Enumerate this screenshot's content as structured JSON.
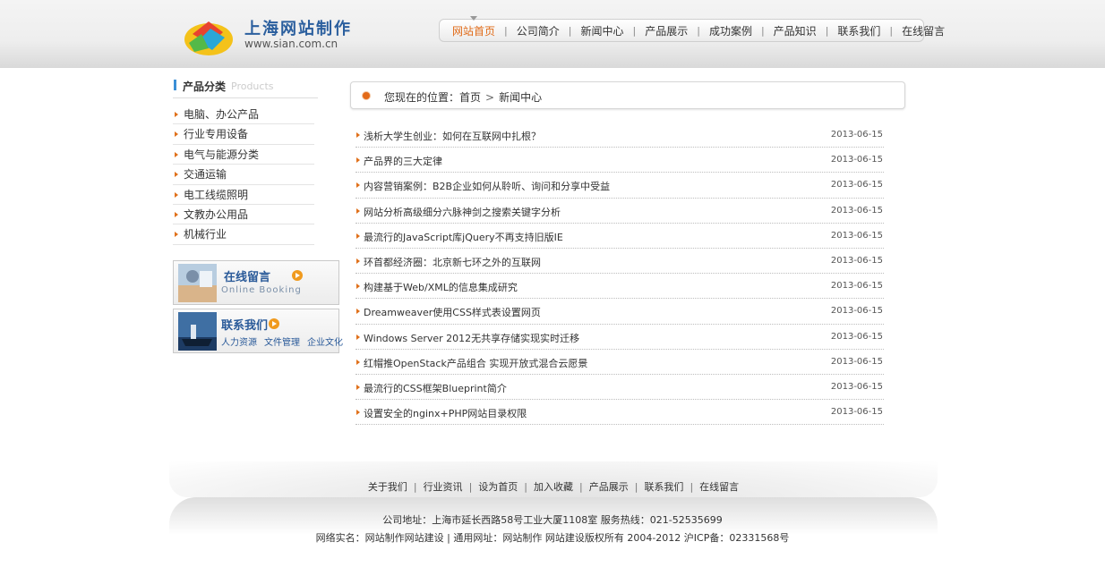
{
  "header": {
    "logo_title": "上海网站制作",
    "logo_url": "www.sian.com.cn",
    "nav": [
      {
        "label": "网站首页",
        "active": true
      },
      {
        "label": "公司简介",
        "active": false
      },
      {
        "label": "新闻中心",
        "active": false
      },
      {
        "label": "产品展示",
        "active": false
      },
      {
        "label": "成功案例",
        "active": false
      },
      {
        "label": "产品知识",
        "active": false
      },
      {
        "label": "联系我们",
        "active": false
      },
      {
        "label": "在线留言",
        "active": false
      }
    ],
    "nav_separator": "|"
  },
  "sidebar": {
    "title": "产品分类",
    "title_en": "Products",
    "categories": [
      "电脑、办公产品",
      "行业专用设备",
      "电气与能源分类",
      "交通运输",
      "电工线缆照明",
      "文教办公用品",
      "机械行业"
    ],
    "booking": {
      "title": "在线留言",
      "subtitle": "Online Booking"
    },
    "contact": {
      "title": "联系我们",
      "links": [
        "人力资源",
        "文件管理",
        "企业文化"
      ]
    }
  },
  "breadcrumb": {
    "prefix": "您现在的位置：",
    "home": "首页",
    "separator": ">",
    "current": "新闻中心"
  },
  "news": [
    {
      "title": "浅析大学生创业：如何在互联网中扎根？",
      "date": "2013-06-15"
    },
    {
      "title": "产品界的三大定律",
      "date": "2013-06-15"
    },
    {
      "title": "内容营销案例：B2B企业如何从聆听、询问和分享中受益",
      "date": "2013-06-15"
    },
    {
      "title": "网站分析高级细分六脉神剑之搜索关键字分析",
      "date": "2013-06-15"
    },
    {
      "title": "最流行的JavaScript库jQuery不再支持旧版IE",
      "date": "2013-06-15"
    },
    {
      "title": "环首都经济圈：北京新七环之外的互联网",
      "date": "2013-06-15"
    },
    {
      "title": "构建基于Web/XML的信息集成研究",
      "date": "2013-06-15"
    },
    {
      "title": "Dreamweaver使用CSS样式表设置网页",
      "date": "2013-06-15"
    },
    {
      "title": "Windows Server 2012无共享存储实现实时迁移",
      "date": "2013-06-15"
    },
    {
      "title": "红帽推OpenStack产品组合 实现开放式混合云愿景",
      "date": "2013-06-15"
    },
    {
      "title": "最流行的CSS框架Blueprint简介",
      "date": "2013-06-15"
    },
    {
      "title": "设置安全的nginx+PHP网站目录权限",
      "date": "2013-06-15"
    }
  ],
  "footer": {
    "links": [
      "关于我们",
      "行业资讯",
      "设为首页",
      "加入收藏",
      "产品展示",
      "联系我们",
      "在线留言"
    ],
    "separator": "|",
    "address_line": "公司地址：上海市延长西路58号工业大厦1108室 服务热线：021-52535699",
    "copyright_line": "网络实名：网站制作网站建设 | 通用网址：网站制作 网站建设版权所有 2004-2012 沪ICP备：02331568号"
  },
  "colors": {
    "accent": "#e06a17",
    "link_blue": "#2a5a99",
    "sidebar_bar": "#3b8fd6"
  }
}
